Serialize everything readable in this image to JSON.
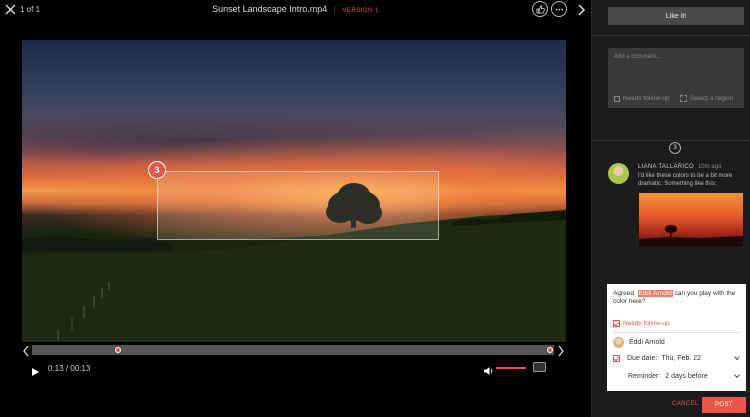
{
  "header": {
    "counter": "1 of 1",
    "file_title": "Sunset Landscape Intro.mp4",
    "separator": "|",
    "version": "VERSION 1"
  },
  "icons": {
    "close": "close-icon",
    "like": "thumbs-up-icon",
    "more": "more-icon",
    "next": "chevron-right-icon"
  },
  "video": {
    "region_marker": "3"
  },
  "controls": {
    "current_time": "0:13",
    "time_sep": "/",
    "duration": "00:13",
    "volume_level": 0.8
  },
  "sidebar": {
    "like_button": "Like it!",
    "comment_placeholder": "Add a comment...",
    "needs_follow_up": "Needs follow-up",
    "select_region": "Select a region",
    "thread_badge": "3"
  },
  "comment": {
    "author": "LIANA TALLARICO",
    "time": "10m ago",
    "text": "I'd like these colors to be a bit more dramatic. Something like this:"
  },
  "reply": {
    "text_before": "Agreed,",
    "mention": "Eddi Arnold",
    "text_after": "can you play with the color here?",
    "needs_follow_up": "Needs follow-up",
    "assignee": "Eddi Arnold",
    "due_label": "Due date:",
    "due_value": "Thu, Feb. 22",
    "reminder_label": "Reminder:",
    "reminder_value": "2 days before",
    "cancel": "CANCEL",
    "post": "POST"
  },
  "colors": {
    "accent": "#e8574a",
    "sidebar_bg": "#1c1c1c"
  }
}
